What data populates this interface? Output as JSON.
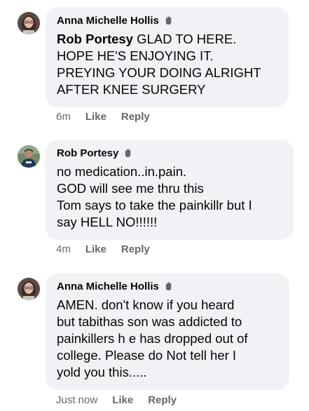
{
  "comments": [
    {
      "author": "Anna Michelle Hollis",
      "mention": "Rob Portesy",
      "lines": [
        " GLAD TO HERE.",
        "HOPE HE'S ENJOYING IT.",
        "PREYING YOUR DOING ALRIGHT",
        "AFTER KNEE SURGERY"
      ],
      "time": "6m",
      "like": "Like",
      "reply": "Reply"
    },
    {
      "author": "Rob Portesy",
      "lines": [
        "no medication..in.pain.",
        "GOD will see me thru this",
        "Tom says to take the painkillr but I",
        "say HELL NO!!!!!!"
      ],
      "time": "4m",
      "like": "Like",
      "reply": "Reply"
    },
    {
      "author": "Anna Michelle Hollis",
      "lines": [
        "AMEN. don't know if you heard",
        "but tabithas son was addicted to",
        "painkillers h e has dropped out of",
        "college. Please do Not tell her I",
        "yold you this....."
      ],
      "time": "Just now",
      "like": "Like",
      "reply": "Reply"
    }
  ],
  "colors": {
    "bubble": "#f0f2f5",
    "text": "#050505",
    "meta": "#65676b"
  },
  "icons": {
    "wave": "waving-hand-icon"
  }
}
